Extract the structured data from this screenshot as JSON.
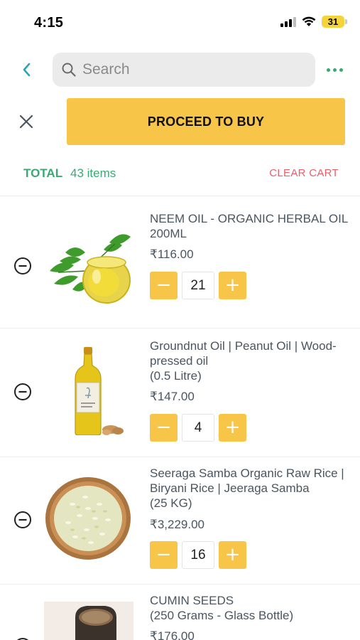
{
  "status_bar": {
    "time": "4:15",
    "battery": "31"
  },
  "header": {
    "search_placeholder": "Search"
  },
  "actions": {
    "proceed_label": "PROCEED TO BUY"
  },
  "summary": {
    "total_label": "TOTAL",
    "item_count": "43 items",
    "clear_cart_label": "CLEAR CART"
  },
  "cart": {
    "items": [
      {
        "name": "NEEM OIL - ORGANIC HERBAL OIL 200ML",
        "price": "₹116.00",
        "quantity": "21",
        "image": "neem-oil-image"
      },
      {
        "name": "Groundnut Oil | Peanut Oil | Wood-pressed oil\n(0.5 Litre)",
        "price": "₹147.00",
        "quantity": "4",
        "image": "groundnut-oil-bottle-image"
      },
      {
        "name": "Seeraga Samba Organic Raw Rice | Biryani Rice | Jeeraga Samba\n(25 KG)",
        "price": "₹3,229.00",
        "quantity": "16",
        "image": "rice-bowl-image"
      },
      {
        "name": "CUMIN SEEDS\n(250 Grams - Glass Bottle)",
        "price": "₹176.00",
        "quantity": "",
        "image": "cumin-seeds-jar-image"
      }
    ]
  },
  "colors": {
    "accent_yellow": "#f7c548",
    "green": "#3aa873",
    "clear_red": "#e8606a",
    "back_teal": "#2aa6b3"
  },
  "icons": {
    "back": "chevron-left-icon",
    "search": "search-icon",
    "more": "more-dots-icon",
    "close": "close-icon",
    "remove": "minus-circle-icon"
  }
}
